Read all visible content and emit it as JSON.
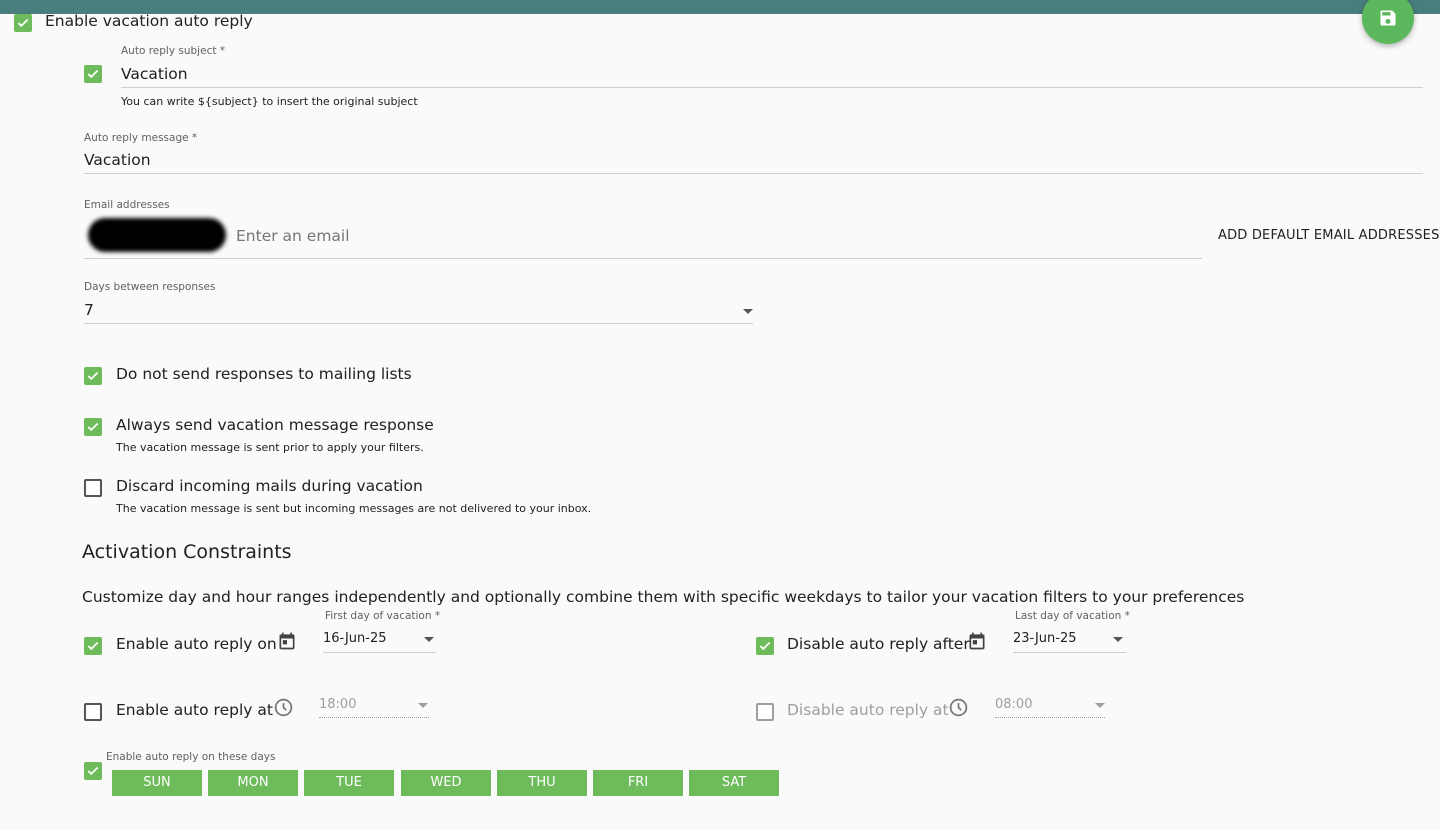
{
  "enable_vacation": {
    "label": "Enable vacation auto reply",
    "checked": true
  },
  "subject": {
    "label": "Auto reply subject *",
    "value": "Vacation",
    "hint": "You can write ${subject} to insert the original subject",
    "checked": true
  },
  "message": {
    "label": "Auto reply message *",
    "value": "Vacation"
  },
  "emails": {
    "label": "Email addresses",
    "placeholder": "Enter an email",
    "add_default": "ADD DEFAULT EMAIL ADDRESSES"
  },
  "days_between": {
    "label": "Days between responses",
    "value": "7"
  },
  "options": {
    "no_mailing_lists": {
      "label": "Do not send responses to mailing lists",
      "checked": true
    },
    "always_send": {
      "label": "Always send vacation message response",
      "hint": "The vacation message is sent prior to apply your filters.",
      "checked": true
    },
    "discard": {
      "label": "Discard incoming mails during vacation",
      "hint": "The vacation message is sent but incoming messages are not delivered to your inbox.",
      "checked": false
    }
  },
  "constraints": {
    "title": "Activation Constraints",
    "description": "Customize day and hour ranges independently and optionally combine them with specific weekdays to tailor your vacation filters to your preferences",
    "enable_on": {
      "label": "Enable auto reply on",
      "field_label": "First day of vacation *",
      "value": "16-Jun-25",
      "checked": true
    },
    "disable_after": {
      "label": "Disable auto reply after",
      "field_label": "Last day of vacation *",
      "value": "23-Jun-25",
      "checked": true
    },
    "enable_at": {
      "label": "Enable auto reply at",
      "value": "18:00",
      "checked": false
    },
    "disable_at": {
      "label": "Disable auto reply at",
      "value": "08:00",
      "checked": false
    },
    "days": {
      "label": "Enable auto reply on these days",
      "checked": true,
      "items": [
        "SUN",
        "MON",
        "TUE",
        "WED",
        "THU",
        "FRI",
        "SAT"
      ]
    }
  },
  "colors": {
    "accent": "#6dbb5a",
    "topbar": "#4a7d7d",
    "fab": "#5cb85c"
  },
  "icons": {
    "save": "save-icon",
    "calendar": "calendar-icon",
    "clock": "clock-icon",
    "check": "check-icon",
    "dropdown": "chevron-down-icon"
  }
}
